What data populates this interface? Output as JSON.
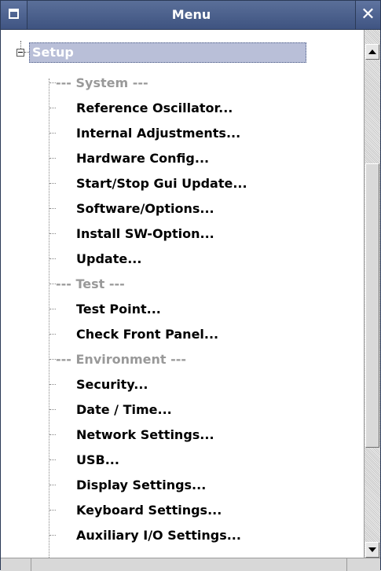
{
  "window": {
    "title": "Menu",
    "close_glyph": "✕",
    "menu_icon": "window-menu-icon"
  },
  "tree": {
    "root_label": "Setup",
    "items": [
      {
        "label": "--- System ---",
        "type": "header"
      },
      {
        "label": "Reference Oscillator...",
        "type": "item"
      },
      {
        "label": "Internal Adjustments...",
        "type": "item"
      },
      {
        "label": "Hardware Config...",
        "type": "item"
      },
      {
        "label": "Start/Stop Gui Update...",
        "type": "item"
      },
      {
        "label": "Software/Options...",
        "type": "item"
      },
      {
        "label": "Install SW-Option...",
        "type": "item"
      },
      {
        "label": "Update...",
        "type": "item"
      },
      {
        "label": "--- Test ---",
        "type": "header"
      },
      {
        "label": "Test Point...",
        "type": "item"
      },
      {
        "label": "Check Front Panel...",
        "type": "item"
      },
      {
        "label": "--- Environment ---",
        "type": "header"
      },
      {
        "label": "Security...",
        "type": "item"
      },
      {
        "label": "Date / Time...",
        "type": "item"
      },
      {
        "label": "Network Settings...",
        "type": "item"
      },
      {
        "label": "USB...",
        "type": "item"
      },
      {
        "label": "Display Settings...",
        "type": "item"
      },
      {
        "label": "Keyboard Settings...",
        "type": "item"
      },
      {
        "label": "Auxiliary I/O Settings...",
        "type": "item"
      }
    ]
  },
  "colors": {
    "titlebar": "#4a5f8c",
    "selection": "#b9bfd8",
    "header_text": "#999999"
  }
}
